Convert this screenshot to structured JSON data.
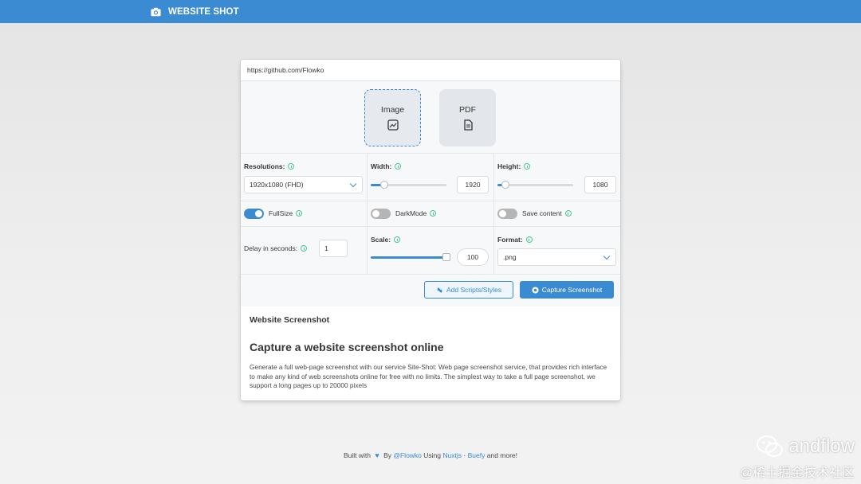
{
  "navbar": {
    "brand_text": "WEBSITE SHOT",
    "brand_icon": "camera-icon"
  },
  "url_input": {
    "value": "https://github.com/Flowko"
  },
  "type_options": [
    {
      "label": "Image",
      "icon": "image-icon",
      "active": true
    },
    {
      "label": "PDF",
      "icon": "document-icon",
      "active": false
    }
  ],
  "resolutions": {
    "label": "Resolutions:",
    "value": "1920x1080 (FHD)"
  },
  "width": {
    "label": "Width:",
    "value": "1920",
    "fraction": 0.18
  },
  "height": {
    "label": "Height:",
    "value": "1080",
    "fraction": 0.1
  },
  "toggles": [
    {
      "label": "FullSize",
      "on": true
    },
    {
      "label": "DarkMode",
      "on": false
    },
    {
      "label": "Save content",
      "on": false
    }
  ],
  "delay": {
    "label": "Delay in seconds:",
    "value": "1"
  },
  "scale": {
    "label": "Scale:",
    "value": "100",
    "fraction": 1.0
  },
  "format": {
    "label": "Format:",
    "value": ".png"
  },
  "buttons": {
    "add_scripts": "Add Scripts/Styles",
    "capture": "Capture Screenshot"
  },
  "content": {
    "heading": "Website Screenshot",
    "title": "Capture a website screenshot online",
    "body": "Generate a full web-page screenshot with our service Site-Shot: Web page screenshot service, that provides rich interface to make any kind of web screenshots online for free with no limits. The simplest way to take a full page screenshot, we support a long pages up to 20000 pixels"
  },
  "footer": {
    "built_with": "Built with",
    "by": "By",
    "author": "@Flowko",
    "using": "Using",
    "nuxt": "Nuxtjs",
    "dot": "·",
    "buefy": "Buefy",
    "more": "and more!"
  },
  "watermark": {
    "line1": "andflow",
    "line2": "@稀土掘金技术社区"
  },
  "colors": {
    "primary": "#3a8bd2",
    "info": "#48c78e"
  }
}
